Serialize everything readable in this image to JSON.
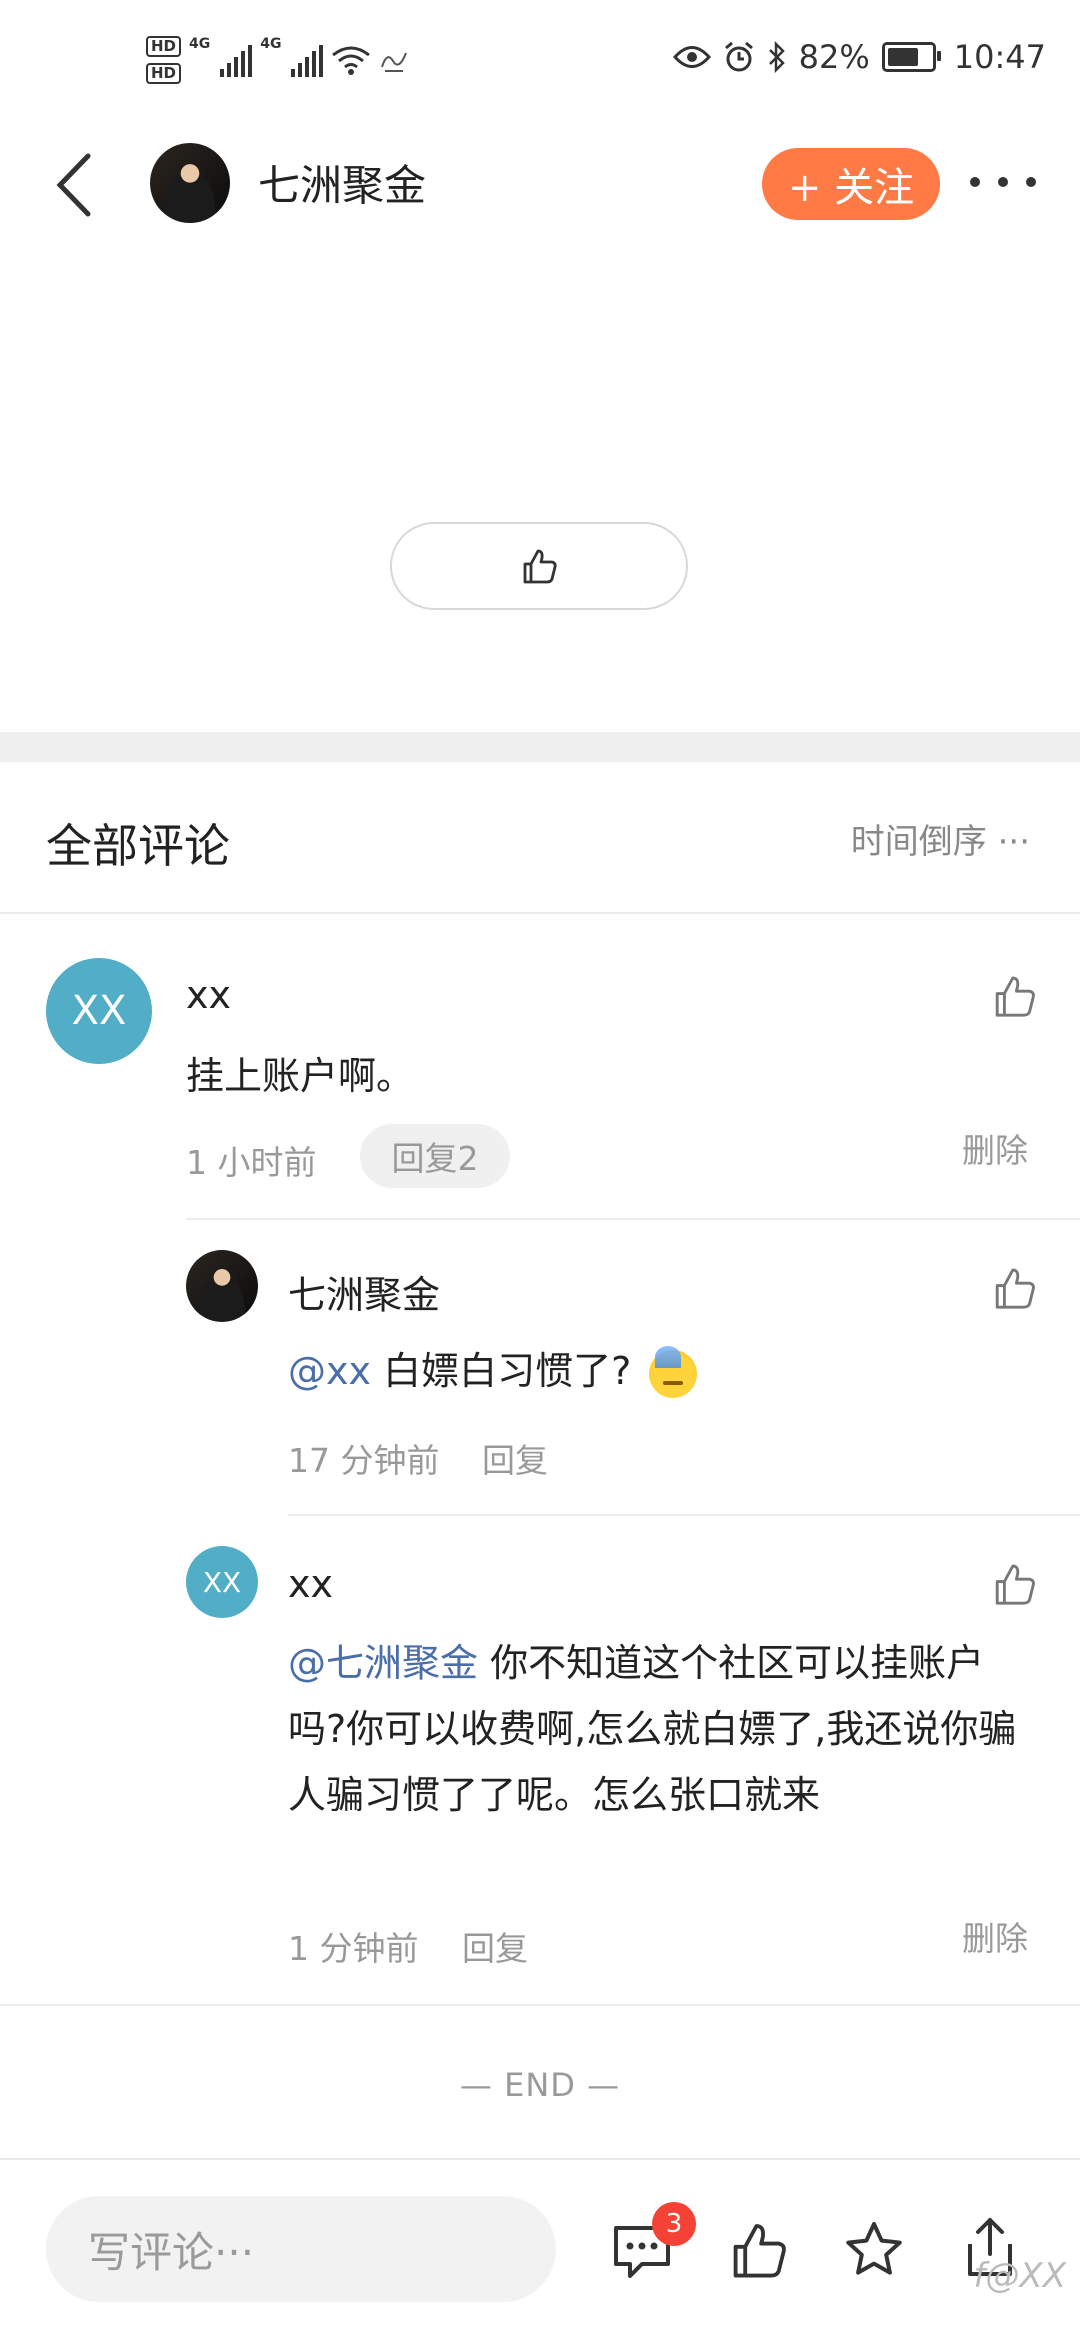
{
  "status_bar": {
    "hd1": "HD",
    "hd2": "HD",
    "net1": "4G",
    "net2": "4G",
    "battery_percent": "82%",
    "time": "10:47",
    "battery_level": 0.82
  },
  "header": {
    "author_name": "七洲聚金",
    "follow_label": "+ 关注"
  },
  "comments_section": {
    "title": "全部评论",
    "sort_label": "时间倒序 ···"
  },
  "comments": [
    {
      "avatar_text": "XX",
      "name": "xx",
      "content": "挂上账户啊。",
      "time": "1 小时前",
      "reply_chip": "回复2",
      "delete_label": "删除",
      "replies": [
        {
          "name": "七洲聚金",
          "mention": "@xx",
          "text": " 白嫖白习惯了?",
          "time": "17 分钟前",
          "reply_label": "回复"
        },
        {
          "avatar_text": "XX",
          "name": "xx",
          "mention": "@七洲聚金",
          "text": " 你不知道这个社区可以挂账户吗?你可以收费啊,怎么就白嫖了,我还说你骗人骗习惯了了呢。怎么张口就来",
          "time": "1 分钟前",
          "reply_label": "回复",
          "delete_label": "删除"
        }
      ]
    }
  ],
  "end_label": "— END —",
  "bottom_bar": {
    "comment_placeholder": "写评论···",
    "comment_count_badge": "3"
  },
  "watermark": "f@XX",
  "colors": {
    "accent": "#ff7a45",
    "mention": "#4a6ea9",
    "avatar_bg": "#52aec6",
    "badge": "#f44336"
  }
}
